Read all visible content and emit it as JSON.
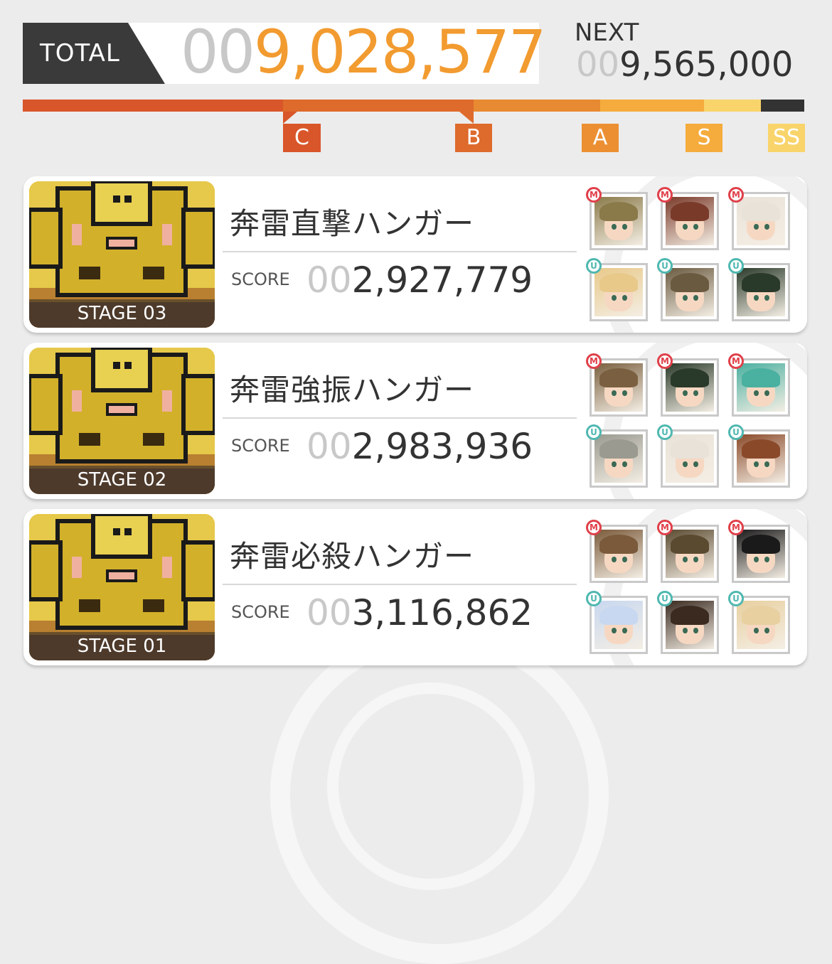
{
  "total": {
    "label": "TOTAL",
    "score_pad": "00",
    "score": "9,028,577",
    "next_label": "NEXT",
    "next_pad": "00",
    "next_score": "9,565,000"
  },
  "colors": {
    "rank_c": "#d9562a",
    "rank_b": "#e37f2f",
    "rank_a": "#f0a033",
    "rank_s": "#f5a93b",
    "rank_ss": "#f8d46b",
    "rank_rest": "#333333",
    "total_accent": "#f29b30",
    "badge_m": "#e0404a",
    "badge_u": "#4fb8b0"
  },
  "ranks": [
    "C",
    "B",
    "A",
    "S",
    "SS"
  ],
  "stages": [
    {
      "stage_label": "STAGE 03",
      "title": "奔雷直撃ハンガー",
      "score_label": "SCORE",
      "score_pad": "00",
      "score": "2,927,779",
      "team": [
        {
          "badge": "M",
          "icon": "character-portrait-icon",
          "hair": "#8a7a4a"
        },
        {
          "badge": "M",
          "icon": "character-portrait-icon",
          "hair": "#7a3a2a"
        },
        {
          "badge": "M",
          "icon": "character-portrait-icon",
          "hair": "#e8e2d8"
        },
        {
          "badge": "U",
          "icon": "character-portrait-icon",
          "hair": "#e8c98a"
        },
        {
          "badge": "U",
          "icon": "character-portrait-icon",
          "hair": "#6a5a40"
        },
        {
          "badge": "U",
          "icon": "character-portrait-icon",
          "hair": "#2a3a2a"
        }
      ]
    },
    {
      "stage_label": "STAGE 02",
      "title": "奔雷強振ハンガー",
      "score_label": "SCORE",
      "score_pad": "00",
      "score": "2,983,936",
      "team": [
        {
          "badge": "M",
          "icon": "character-portrait-icon",
          "hair": "#7a6040"
        },
        {
          "badge": "M",
          "icon": "character-portrait-icon",
          "hair": "#2a3a2a"
        },
        {
          "badge": "M",
          "icon": "character-portrait-icon",
          "hair": "#4ab0a0"
        },
        {
          "badge": "U",
          "icon": "character-portrait-icon",
          "hair": "#9a9a90"
        },
        {
          "badge": "U",
          "icon": "character-portrait-icon",
          "hair": "#e8e2d8"
        },
        {
          "badge": "U",
          "icon": "character-portrait-icon",
          "hair": "#8a4a2a"
        }
      ]
    },
    {
      "stage_label": "STAGE 01",
      "title": "奔雷必殺ハンガー",
      "score_label": "SCORE",
      "score_pad": "00",
      "score": "3,116,862",
      "team": [
        {
          "badge": "M",
          "icon": "character-portrait-icon",
          "hair": "#7a5a3a"
        },
        {
          "badge": "M",
          "icon": "character-portrait-icon",
          "hair": "#5a4a30"
        },
        {
          "badge": "M",
          "icon": "character-portrait-icon",
          "hair": "#1a1a1a"
        },
        {
          "badge": "U",
          "icon": "character-portrait-icon",
          "hair": "#c8d8f0"
        },
        {
          "badge": "U",
          "icon": "character-portrait-icon",
          "hair": "#3a2a20"
        },
        {
          "badge": "U",
          "icon": "character-portrait-icon",
          "hair": "#e8d0a0"
        }
      ]
    }
  ]
}
